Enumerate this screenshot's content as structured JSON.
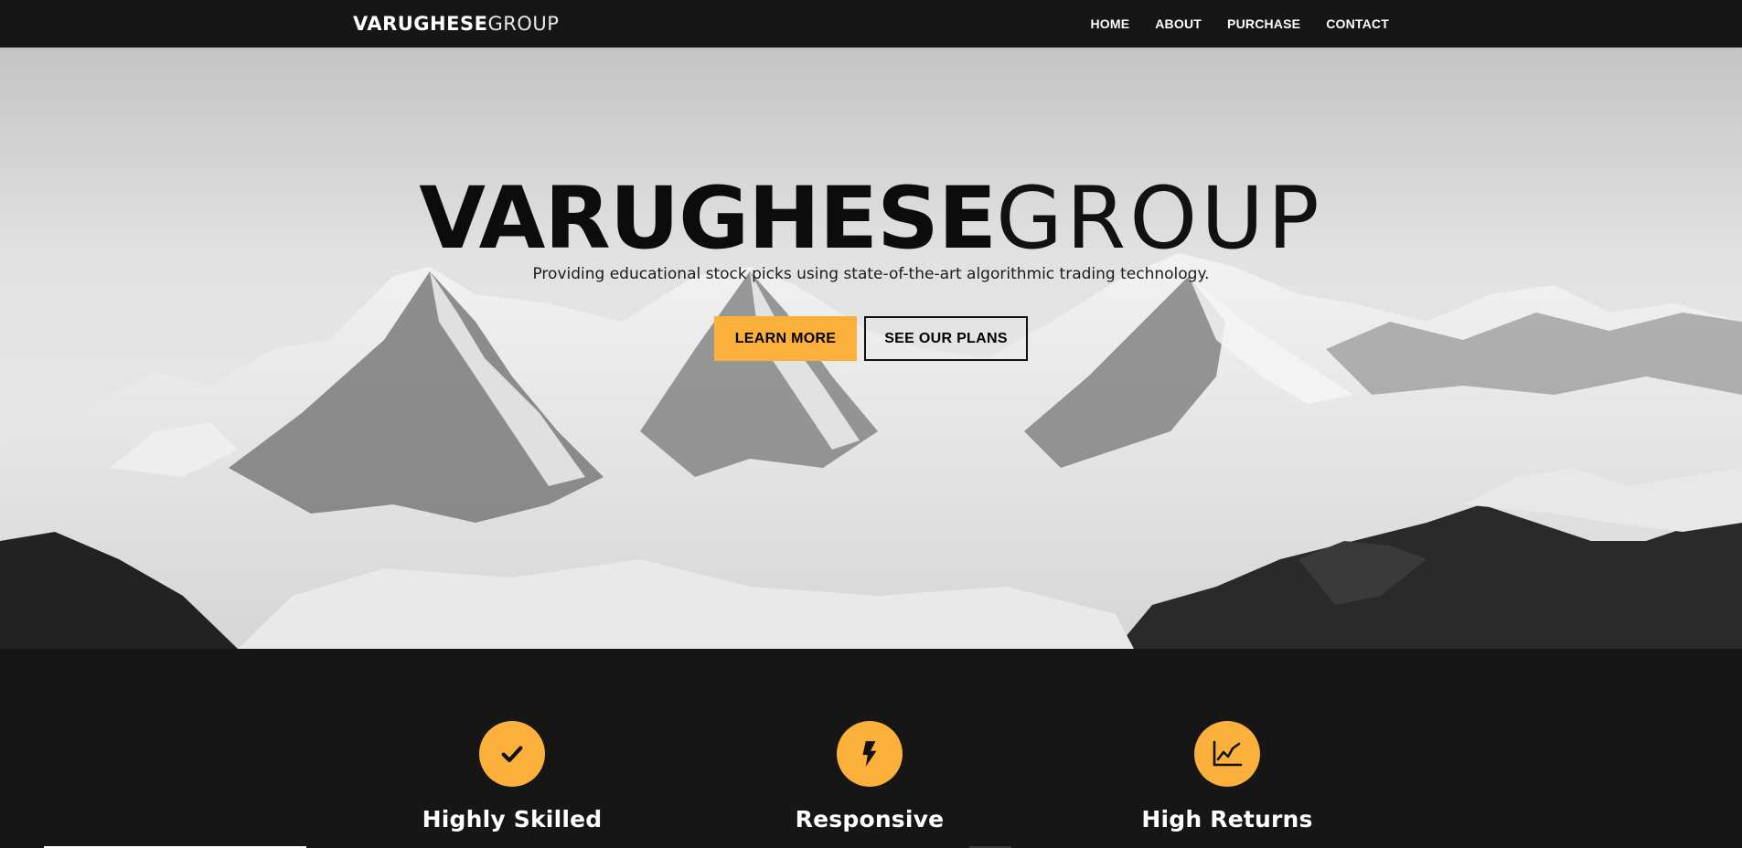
{
  "navbar": {
    "brand_bold": "VARUGHESE",
    "brand_light": "GROUP",
    "links": [
      "HOME",
      "ABOUT",
      "PURCHASE",
      "CONTACT"
    ]
  },
  "hero": {
    "title_bold": "VARUGHESE",
    "title_light": "GROUP",
    "subtitle": "Providing educational stock picks using state-of-the-art algorithmic trading technology.",
    "primary_button": "LEARN MORE",
    "secondary_button": "SEE OUR PLANS",
    "background_image": "black-and-white snowy mountain range"
  },
  "features": [
    {
      "icon": "check-icon",
      "title": "Highly Skilled"
    },
    {
      "icon": "bolt-icon",
      "title": "Responsive"
    },
    {
      "icon": "chart-line-icon",
      "title": "High Returns"
    }
  ],
  "colors": {
    "accent": "#fbb03b",
    "dark_background": "#161616"
  }
}
